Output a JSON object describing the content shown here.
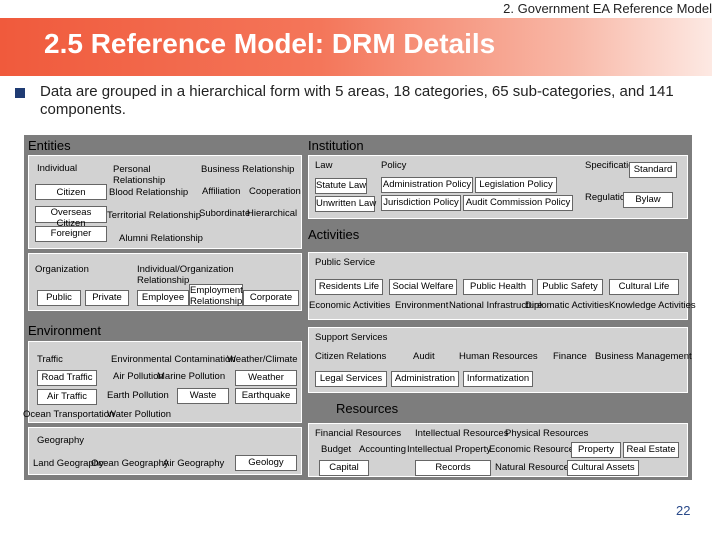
{
  "header": {
    "section": "2. Government EA Reference Model"
  },
  "title": "2.5 Reference Model: DRM Details",
  "description": "Data are grouped in a hierarchical form with 5 areas, 18 categories, 65 sub-categories, and 141 components.",
  "diagram": {
    "entities": {
      "title": "Entities",
      "individual": {
        "label": "Individual",
        "items": [
          "Citizen",
          "Overseas Citizen",
          "Foreigner"
        ]
      },
      "relationships": [
        "Personal Relationship",
        "Blood Relationship",
        "Territorial Relationship",
        "Alumni Relationship",
        "Business Relationship",
        "Affiliation",
        "Cooperation",
        "Subordinate",
        "Hierarchical"
      ],
      "organization": {
        "label": "Organization",
        "items": [
          "Public",
          "Private"
        ]
      },
      "ind_org": {
        "label": "Individual/Organization Relationship",
        "items": [
          "Employee",
          "Employment Relationship",
          "Corporate"
        ]
      }
    },
    "institution": {
      "title": "Institution",
      "law": {
        "label": "Law",
        "items": [
          "Statute Law",
          "Unwritten Law"
        ]
      },
      "policy": {
        "label": "Policy",
        "items": [
          "Administration Policy",
          "Legislation Policy",
          "Jurisdiction Policy",
          "Audit Commission Policy"
        ]
      },
      "specific": {
        "label": "Specification",
        "item": "Standard"
      },
      "regulation": {
        "label": "Regulation",
        "item": "Bylaw"
      }
    },
    "activities": {
      "title": "Activities",
      "public_service": {
        "label": "Public Service",
        "items": [
          "Residents Life",
          "Social Welfare",
          "Public Health",
          "Public Safety",
          "Cultural Life",
          "Economic Activities",
          "Environment",
          "National Infrastructure",
          "Diplomatic Activities",
          "Knowledge Activities"
        ]
      },
      "support_services": {
        "label": "Support Services",
        "items": [
          "Citizen Relations",
          "Audit",
          "Human Resources",
          "Finance",
          "Business Management",
          "Legal Services",
          "Administration",
          "Informatization"
        ]
      }
    },
    "environment": {
      "title": "Environment",
      "traffic": {
        "label": "Traffic",
        "items": [
          "Road Traffic",
          "Air Traffic",
          "Ocean Transportation"
        ]
      },
      "contamination": {
        "label": "Environmental Contamination",
        "items": [
          "Air Pollution",
          "Marine Pollution",
          "Earth Pollution",
          "Waste",
          "Water Pollution"
        ]
      },
      "weather": {
        "label": "Weather/Climate",
        "items": [
          "Weather",
          "Earthquake"
        ]
      },
      "geography": {
        "label": "Geography",
        "items": [
          "Land Geography",
          "Ocean Geography",
          "Air Geography",
          "Geology"
        ]
      }
    },
    "resources": {
      "title": "Resources",
      "financial": {
        "label": "Financial Resources",
        "items": [
          "Budget",
          "Accounting",
          "Capital"
        ]
      },
      "intellectual": {
        "label": "Intellectual Resources",
        "items": [
          "Intellectual Property",
          "Records"
        ]
      },
      "physical": {
        "label": "Physical Resources",
        "items": [
          "Economic Resources",
          "Property",
          "Real Estate",
          "Natural Resources",
          "Cultural Assets"
        ]
      }
    }
  },
  "page_number": "22"
}
